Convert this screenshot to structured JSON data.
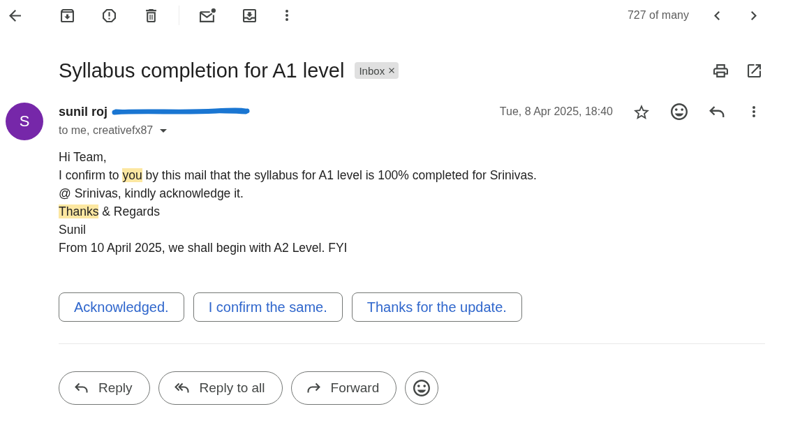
{
  "toolbar": {
    "position": "727 of many"
  },
  "subject": "Syllabus completion for A1 level",
  "labels": [
    {
      "text": "Inbox"
    }
  ],
  "message": {
    "sender": {
      "initial": "S",
      "name": "sunil roj"
    },
    "recipients": "to me, creativefx87",
    "date": "Tue, 8 Apr 2025, 18:40",
    "starred": false,
    "body": [
      {
        "segments": [
          {
            "text": "Hi Team,",
            "highlighted": false
          }
        ]
      },
      {
        "segments": [
          {
            "text": "I confirm to ",
            "highlighted": false
          },
          {
            "text": "you",
            "highlighted": true
          },
          {
            "text": " by this mail that the syllabus for A1 level is 100% completed for Srinivas.",
            "highlighted": false
          }
        ]
      },
      {
        "segments": [
          {
            "text": "@ Srinivas, kindly acknowledge it.",
            "highlighted": false
          }
        ]
      },
      {
        "segments": [
          {
            "text": "Thanks",
            "highlighted": true
          },
          {
            "text": " & Regards",
            "highlighted": false
          }
        ]
      },
      {
        "segments": [
          {
            "text": "Sunil",
            "highlighted": false
          }
        ]
      },
      {
        "segments": [
          {
            "text": "From 10 April 2025, we shall begin with A2 Level. FYI",
            "highlighted": false
          }
        ]
      }
    ]
  },
  "smart_replies": [
    "Acknowledged.",
    "I confirm the same.",
    "Thanks for the update."
  ],
  "actions": [
    {
      "kind": "reply",
      "label": "Reply"
    },
    {
      "kind": "reply_all",
      "label": "Reply to all"
    },
    {
      "kind": "forward",
      "label": "Forward"
    },
    {
      "kind": "emoji"
    }
  ]
}
